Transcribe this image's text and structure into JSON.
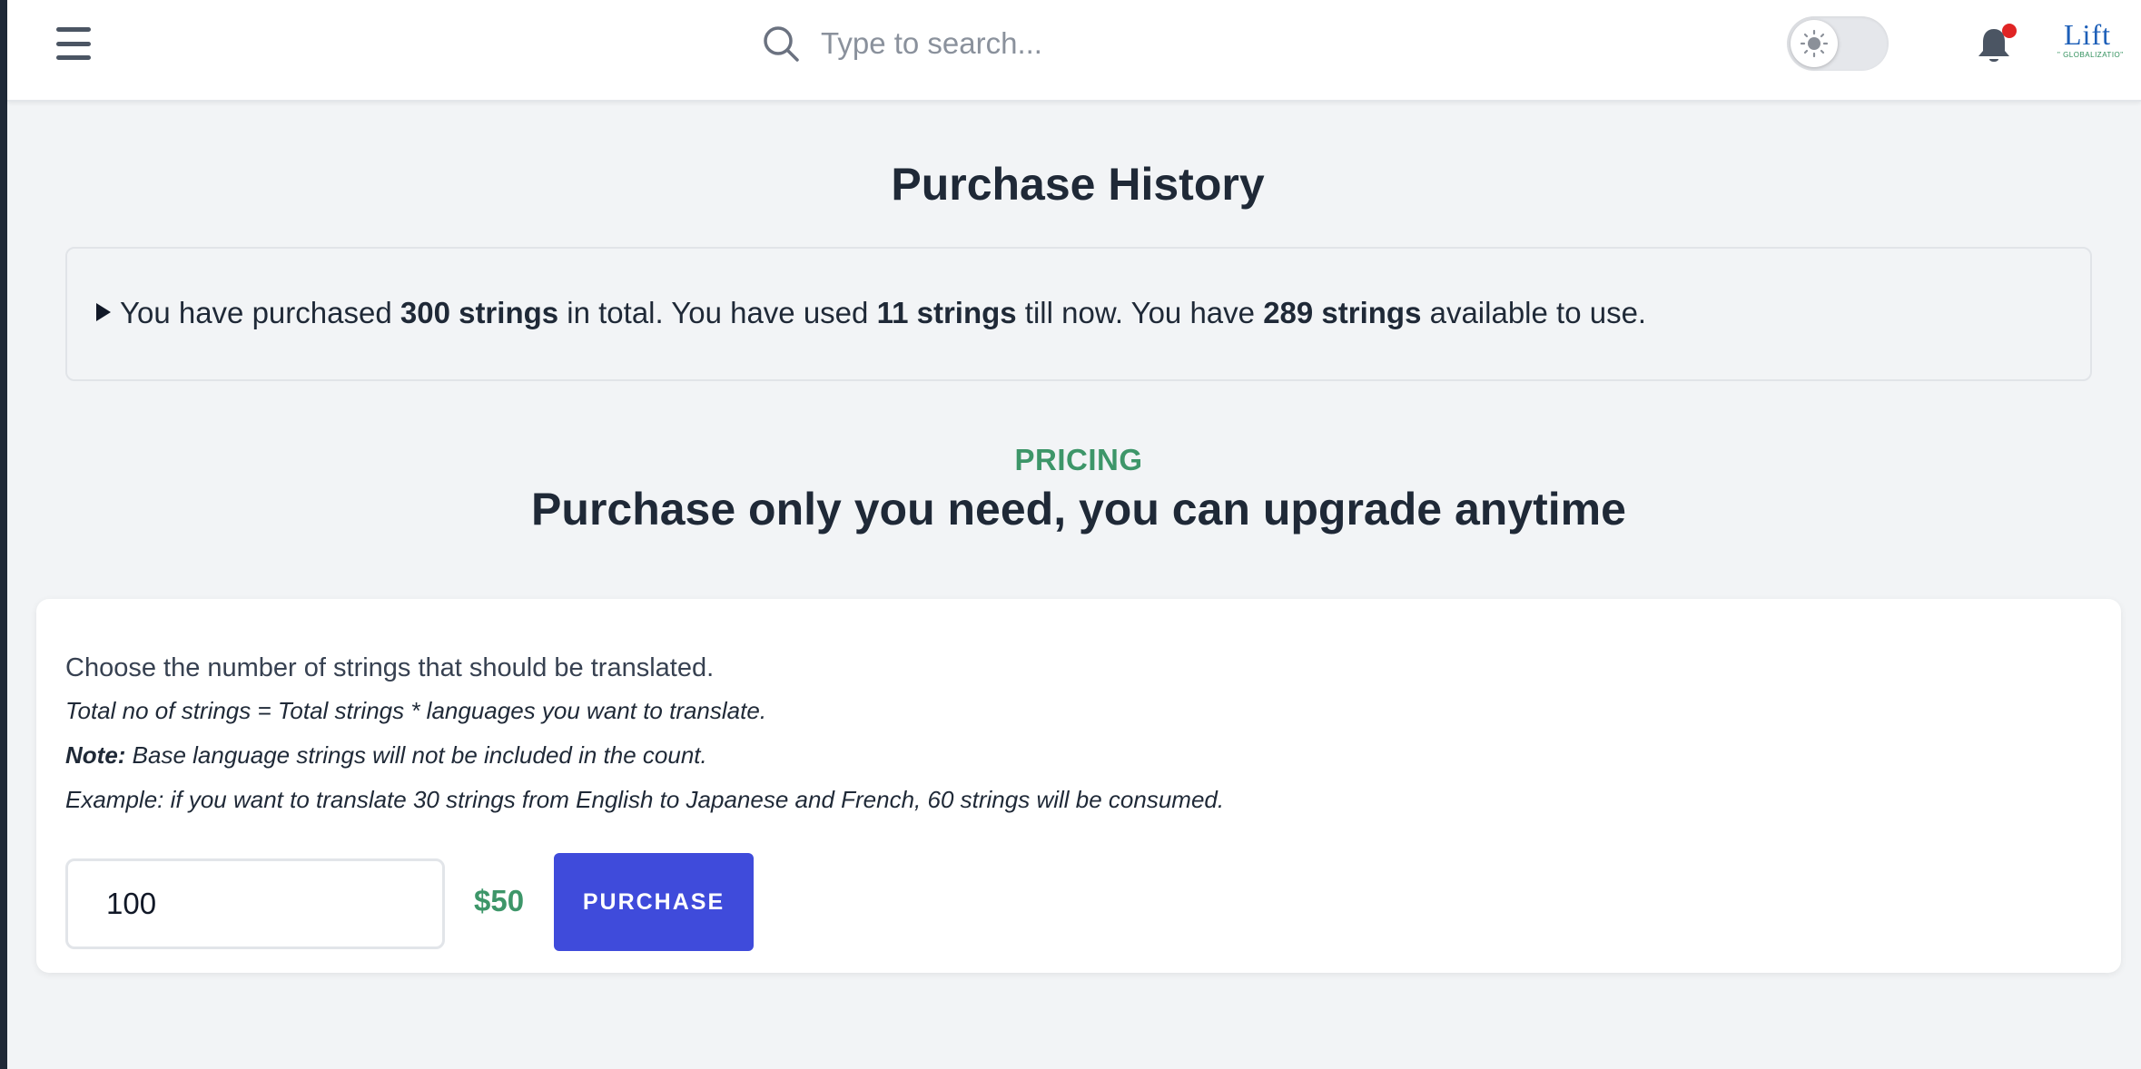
{
  "header": {
    "menu_icon": "hamburger-menu-icon",
    "search": {
      "placeholder": "Type to search...",
      "value": ""
    },
    "theme_toggle_icon": "sun-icon",
    "notifications_icon": "bell-icon",
    "logo": {
      "text": "Lift",
      "tagline": "\" GLOBALIZATIO\""
    }
  },
  "page": {
    "title": "Purchase History",
    "summary": {
      "prefix": "You have purchased ",
      "purchased": "300 strings",
      "mid1": " in total. You have used ",
      "used": "11 strings",
      "mid2": " till now. You have ",
      "available": "289 strings",
      "suffix": " available to use."
    }
  },
  "pricing": {
    "eyebrow": "PRICING",
    "heading": "Purchase only you need, you can upgrade anytime",
    "intro": "Choose the number of strings that should be translated.",
    "formula": "Total no of strings = Total strings * languages you want to translate.",
    "note_label": "Note:",
    "note_text": " Base language strings will not be included in the count.",
    "example": "Example: if you want to translate 30 strings from English to Japanese and French, 60 strings will be consumed.",
    "quantity": "100",
    "price": "$50",
    "purchase_label": "PURCHASE"
  },
  "colors": {
    "accent_green": "#3d9669",
    "button_blue": "#3f4bdb",
    "notification_red": "#e02424",
    "logo_blue": "#1d5fb8"
  }
}
